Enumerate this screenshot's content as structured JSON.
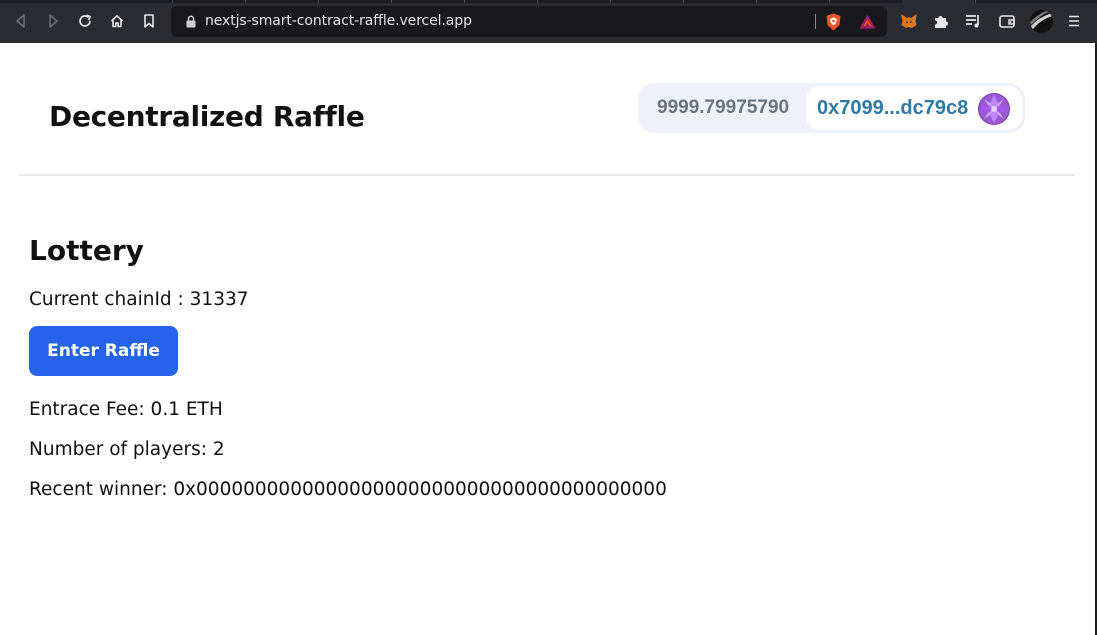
{
  "browser": {
    "url": "nextjs-smart-contract-raffle.vercel.app",
    "icons": [
      "back-icon",
      "forward-icon",
      "reload-icon",
      "home-icon",
      "bookmark-icon",
      "lock-icon",
      "brave-shield-icon",
      "brave-rewards-icon",
      "metamask-icon",
      "extensions-icon",
      "playlist-icon",
      "wallet-icon",
      "profile-icon",
      "menu-icon"
    ]
  },
  "header": {
    "title": "Decentralized Raffle"
  },
  "wallet": {
    "balance": "9999.79975790",
    "address": "0x7099...dc79c8"
  },
  "lottery": {
    "heading": "Lottery",
    "chain_line": "Current chainId : 31337",
    "enter_button": "Enter Raffle",
    "fee_line": "Entrace Fee: 0.1 ETH",
    "players_line": "Number of players: 2",
    "winner_line": "Recent winner: 0x0000000000000000000000000000000000000000"
  },
  "colors": {
    "accent": "#2563eb",
    "address": "#2c7aa5",
    "balance": "#6b7280",
    "chrome": "#2b2b32"
  }
}
